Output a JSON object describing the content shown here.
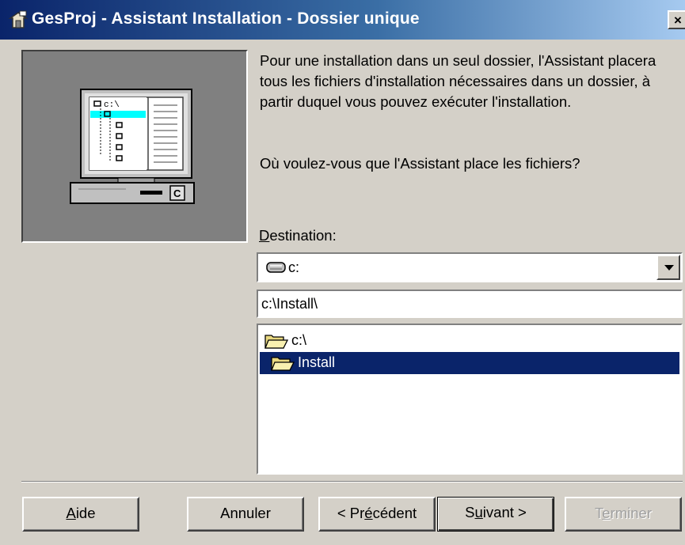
{
  "window": {
    "title": "GesProj - Assistant Installation - Dossier unique",
    "close_label": "×"
  },
  "main": {
    "description": "Pour une installation dans un seul dossier, l'Assistant placera tous les fichiers d'installation nécessaires dans un dossier, à partir duquel vous pouvez exécuter l'installation.",
    "question": "Où voulez-vous que l'Assistant place les fichiers?",
    "destination_label_accel": "D",
    "destination_label_rest": "estination:",
    "drive_value": "c:",
    "path_value": "c:\\Install\\",
    "folders": [
      {
        "label": "c:\\",
        "selected": false
      },
      {
        "label": "Install",
        "selected": true
      }
    ],
    "illustration": {
      "screen_label": "c:\\",
      "drive_letter": "C"
    }
  },
  "buttons": {
    "help": {
      "accel": "A",
      "rest": "ide"
    },
    "cancel": {
      "label": "Annuler"
    },
    "prev": {
      "before": "< Pr",
      "accel": "é",
      "after": "cédent"
    },
    "next": {
      "before": "S",
      "accel": "u",
      "after": "ivant >"
    },
    "finish": {
      "before": "T",
      "accel": "e",
      "after": "rminer",
      "disabled": true
    }
  },
  "colors": {
    "title_bar_start": "#0a246a",
    "title_bar_end": "#a6caf0",
    "selection": "#0a246a",
    "face": "#d4d0c8"
  }
}
